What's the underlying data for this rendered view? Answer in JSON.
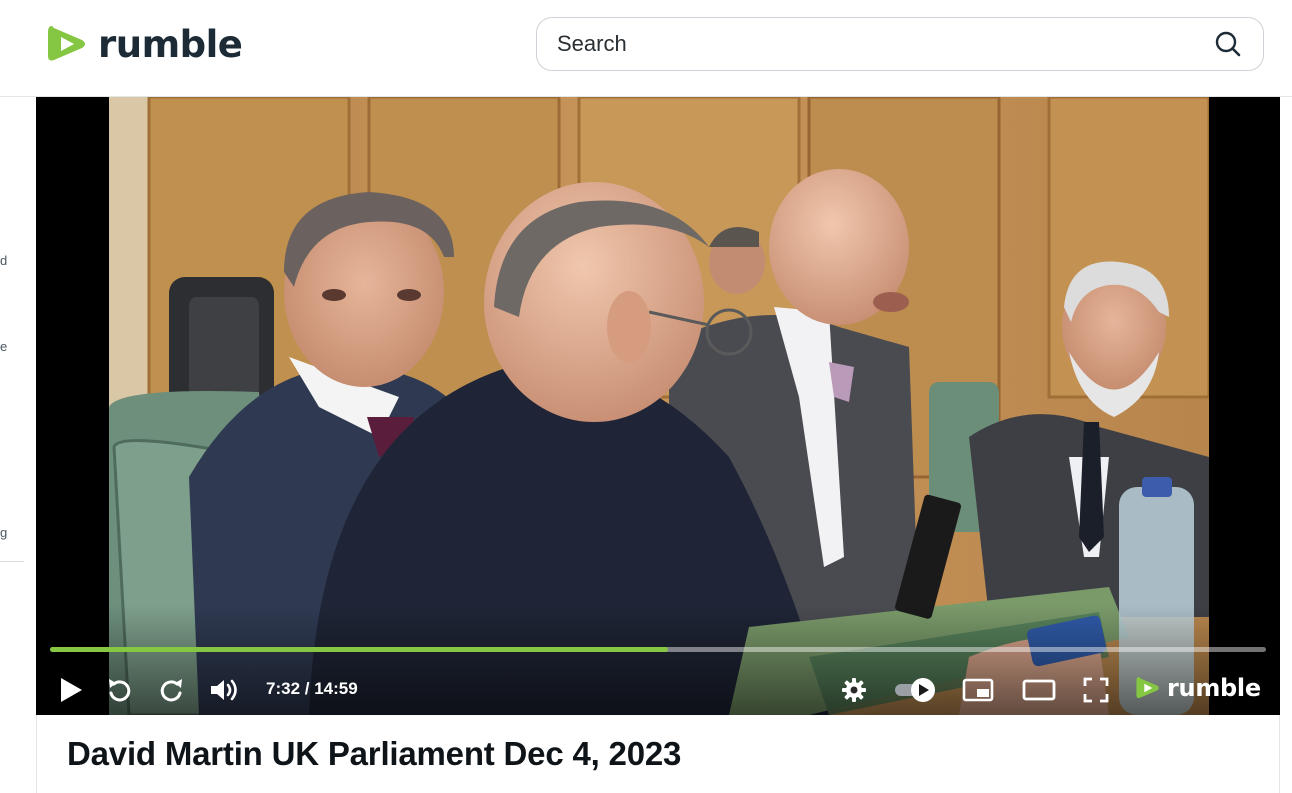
{
  "brand": {
    "name": "rumble",
    "accent": "#85c742"
  },
  "search": {
    "placeholder": "Search",
    "icon": "search-icon"
  },
  "sidebar": {
    "clipped_letters": [
      "d",
      "e",
      "g"
    ]
  },
  "player": {
    "progress_fraction": 0.508,
    "time_display": "7:32 / 14:59",
    "logo_text": "rumble",
    "controls": [
      "play-icon",
      "rewind-icon",
      "forward-icon",
      "volume-icon",
      "settings-gear-icon",
      "autoplay-toggle",
      "picture-in-picture-icon",
      "theater-mode-icon",
      "fullscreen-icon"
    ]
  },
  "video": {
    "title": "David Martin UK Parliament Dec 4, 2023"
  }
}
